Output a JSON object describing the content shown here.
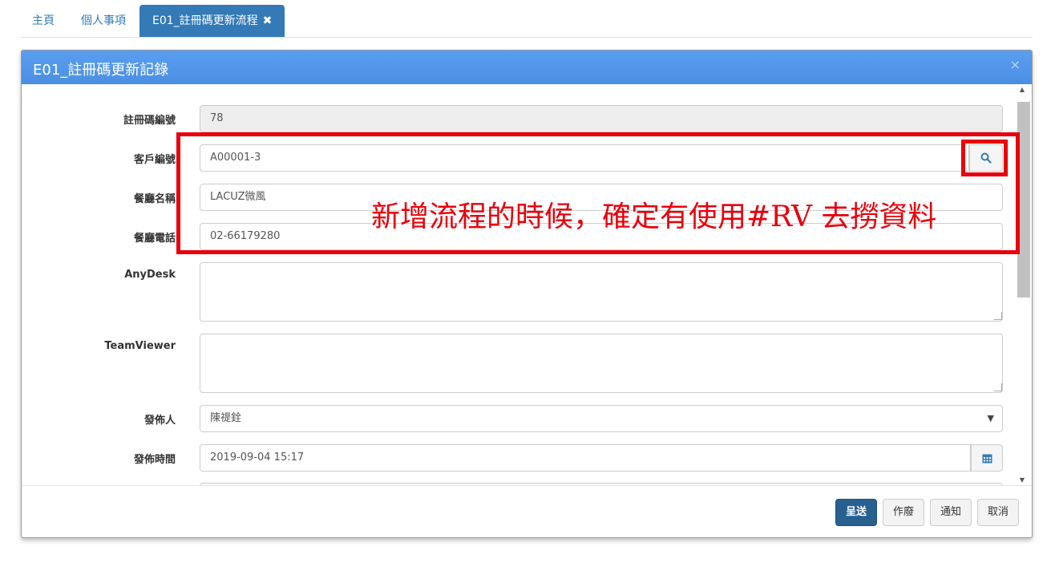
{
  "tabs": [
    {
      "label": "主頁"
    },
    {
      "label": "個人事項"
    },
    {
      "label": "E01_註冊碼更新流程",
      "close": "✖"
    }
  ],
  "modal": {
    "title": "E01_註冊碼更新記錄",
    "close": "×"
  },
  "form": {
    "reg_no": {
      "label": "註冊碼編號",
      "value": "78"
    },
    "customer_no": {
      "label": "客戶編號",
      "value": "A00001-3"
    },
    "restaurant_name": {
      "label": "餐廳名稱",
      "value": "LACUZ微風"
    },
    "restaurant_phone": {
      "label": "餐廳電話",
      "value": "02-66179280"
    },
    "anydesk": {
      "label": "AnyDesk",
      "value": ""
    },
    "teamviewer": {
      "label": "TeamViewer",
      "value": ""
    },
    "publisher": {
      "label": "發佈人",
      "value": "陳禔銓"
    },
    "publish_time": {
      "label": "發佈時間",
      "value": "2019-09-04 15:17"
    }
  },
  "footer": {
    "submit": "呈送",
    "void": "作廢",
    "notify": "通知",
    "cancel": "取消"
  },
  "annotation": {
    "text": "新增流程的時候，確定有使用#RV 去撈資料",
    "color": "#e8000b"
  },
  "colors": {
    "header": "#4a90e2",
    "primary": "#286090",
    "link": "#337ab7"
  }
}
